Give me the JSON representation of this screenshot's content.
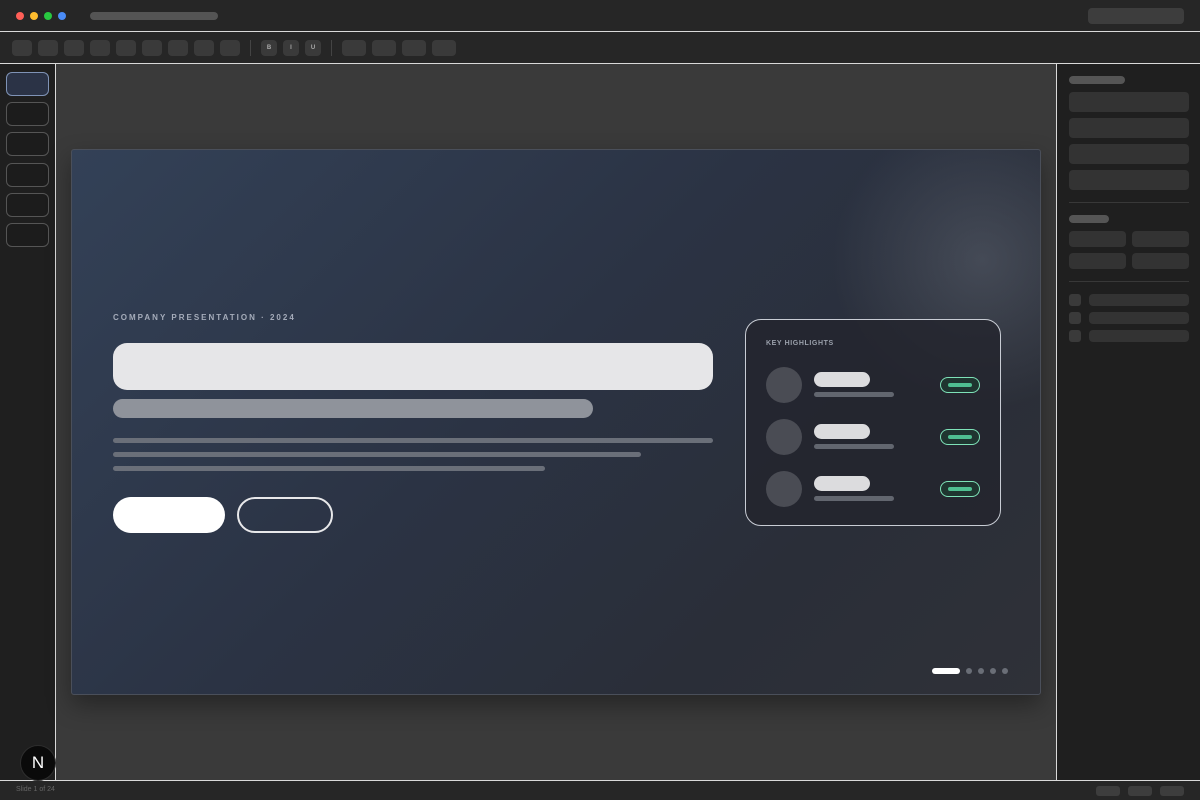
{
  "colors": {
    "traffic_close": "#ff5f57",
    "traffic_minimize": "#febc2e",
    "traffic_maximize": "#28c840",
    "traffic_extra": "#4a8cf7",
    "accent_badge": "#4fbf91",
    "slide_active_thumb": "#7f93b6"
  },
  "toolbar": {
    "format_bold": "B",
    "format_italic": "I",
    "format_underline": "U"
  },
  "slide": {
    "eyebrow": "COMPANY PRESENTATION · 2024",
    "highlights_title": "KEY HIGHLIGHTS",
    "total_pages": 5,
    "current_page": 1
  },
  "status": {
    "slide_counter": "Slide 1 of 24"
  },
  "logo": {
    "letter": "N",
    "icon": "n-logo-icon"
  }
}
